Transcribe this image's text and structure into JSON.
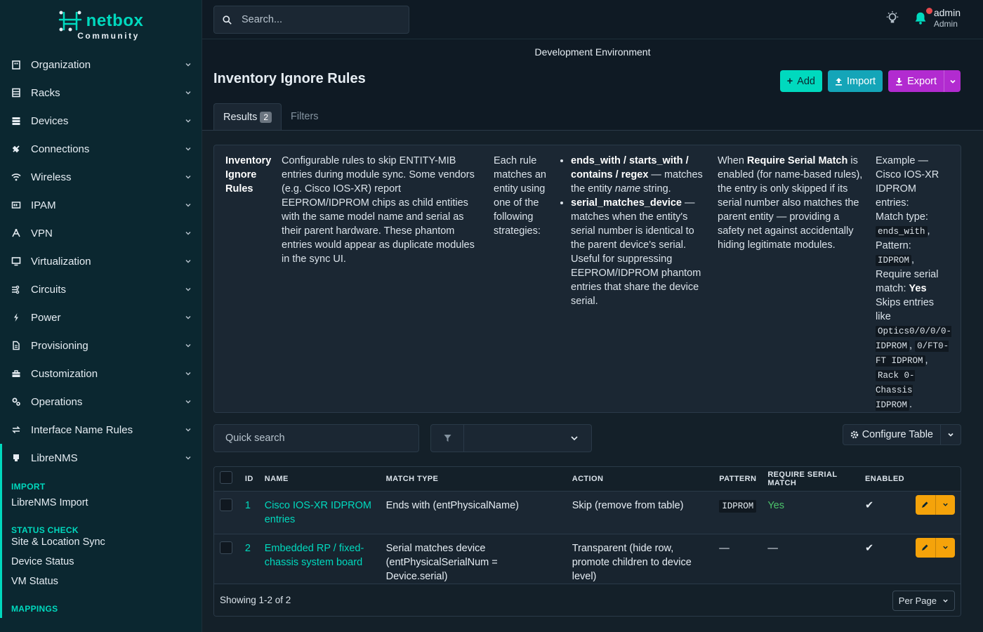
{
  "brand": {
    "name": "netbox",
    "edition": "Community"
  },
  "sidebar": {
    "items": [
      {
        "label": "Organization",
        "icon": "building-icon"
      },
      {
        "label": "Racks",
        "icon": "rack-icon"
      },
      {
        "label": "Devices",
        "icon": "server-icon"
      },
      {
        "label": "Connections",
        "icon": "plug-icon"
      },
      {
        "label": "Wireless",
        "icon": "wifi-icon"
      },
      {
        "label": "IPAM",
        "icon": "counter-icon"
      },
      {
        "label": "VPN",
        "icon": "tunnel-icon"
      },
      {
        "label": "Virtualization",
        "icon": "monitor-icon"
      },
      {
        "label": "Circuits",
        "icon": "circuit-icon"
      },
      {
        "label": "Power",
        "icon": "bolt-icon"
      },
      {
        "label": "Provisioning",
        "icon": "file-icon"
      },
      {
        "label": "Customization",
        "icon": "toolbox-icon"
      },
      {
        "label": "Operations",
        "icon": "cogs-icon"
      },
      {
        "label": "Interface Name Rules",
        "icon": "swap-icon"
      },
      {
        "label": "LibreNMS",
        "icon": "plugin-icon"
      }
    ],
    "sub": {
      "import_head": "IMPORT",
      "import_links": [
        "LibreNMS Import"
      ],
      "status_head": "STATUS CHECK",
      "status_links": [
        "Site & Location Sync",
        "Device Status",
        "VM Status"
      ],
      "mappings_head": "MAPPINGS"
    }
  },
  "topbar": {
    "search_placeholder": "Search...",
    "user_name": "admin",
    "user_role": "Admin"
  },
  "env_banner": "Development Environment",
  "page": {
    "title": "Inventory Ignore Rules",
    "add_label": "Add",
    "import_label": "Import",
    "export_label": "Export",
    "tab_results": "Results",
    "tab_results_count": "2",
    "tab_filters": "Filters"
  },
  "info": {
    "col1_title": "Inventory Ignore Rules",
    "col2": "Configurable rules to skip ENTITY-MIB entries during module sync. Some vendors (e.g. Cisco IOS-XR) report EEPROM/IDPROM chips as child entities with the same model name and serial as their parent hardware. These phantom entries would appear as duplicate modules in the sync UI.",
    "col3": "Each rule matches an entity using one of the following strategies:",
    "bullet1_bold": "ends_with / starts_with / contains / regex",
    "bullet1_pre": " — matches the entity ",
    "bullet1_em": "name",
    "bullet1_post": " string.",
    "bullet2_bold": "serial_matches_device",
    "bullet2_rest": " — matches when the entity's serial number is identical to the parent device's serial. Useful for suppressing EEPROM/IDPROM phantom entries that share the device serial.",
    "col5_pre": "When ",
    "col5_bold": "Require Serial Match",
    "col5_post": " is enabled (for name-based rules), the entry is only skipped if its serial number also matches the parent entity — providing a safety net against accidentally hiding legitimate modules.",
    "col6_l1": "Example — Cisco IOS-XR IDPROM entries:",
    "col6_match": "Match type: ",
    "col6_match_code": "ends_with",
    "col6_pattern": "Pattern: ",
    "col6_pattern_code": "IDPROM",
    "col6_serial": "Require serial match: ",
    "col6_serial_bold": "Yes",
    "col6_skips": "Skips entries like ",
    "col6_ex1": "Optics0/0/0/0-IDPROM",
    "col6_ex2": "0/FT0-FT IDPROM",
    "col6_ex3": "Rack 0-Chassis IDPROM"
  },
  "toolbar": {
    "quick_search_placeholder": "Quick search",
    "configure_label": "Configure Table"
  },
  "table": {
    "headers": [
      "ID",
      "NAME",
      "MATCH TYPE",
      "ACTION",
      "PATTERN",
      "REQUIRE SERIAL MATCH",
      "ENABLED"
    ],
    "rows": [
      {
        "id": "1",
        "name": "Cisco IOS-XR IDPROM entries",
        "match_type": "Ends with (entPhysicalName)",
        "action": "Skip (remove from table)",
        "pattern": "IDPROM",
        "serial": "Yes",
        "enabled": "✔"
      },
      {
        "id": "2",
        "name": "Embedded RP / fixed-chassis system board",
        "match_type": "Serial matches device (entPhysicalSerialNum = Device.serial)",
        "action": "Transparent (hide row, promote children to device level)",
        "pattern": "—",
        "serial": "—",
        "enabled": "✔"
      }
    ],
    "footer": "Showing 1-2 of 2",
    "per_page": "Per Page"
  }
}
